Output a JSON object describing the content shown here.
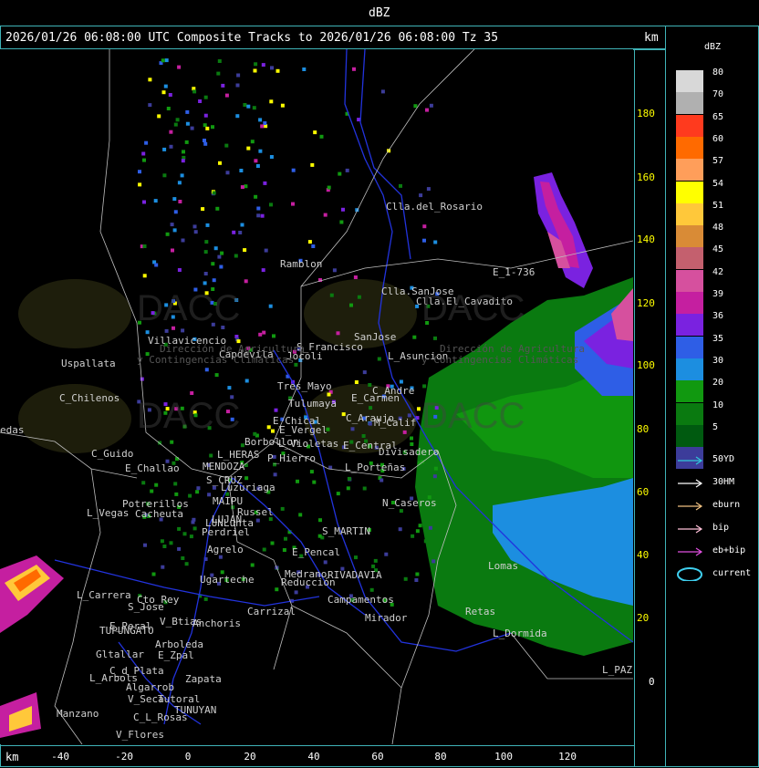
{
  "header": {
    "unit_top": "dBZ",
    "title": "2026/01/26 06:08:00 UTC Composite Tracks to 2026/01/26 06:08:00 Tz 35",
    "km_label_top": "km",
    "km_label_bottom": "km"
  },
  "legend": {
    "title": "dBZ",
    "levels": [
      {
        "value": "80",
        "color": "#d8d8d8"
      },
      {
        "value": "70",
        "color": "#b0b0b0"
      },
      {
        "value": "65",
        "color": "#ff3a1e"
      },
      {
        "value": "60",
        "color": "#ff6a00"
      },
      {
        "value": "57",
        "color": "#ff9e5a"
      },
      {
        "value": "54",
        "color": "#ffff00"
      },
      {
        "value": "51",
        "color": "#ffc83a"
      },
      {
        "value": "48",
        "color": "#d98b36"
      },
      {
        "value": "45",
        "color": "#c4606e"
      },
      {
        "value": "42",
        "color": "#d6509e"
      },
      {
        "value": "39",
        "color": "#c51fa0"
      },
      {
        "value": "36",
        "color": "#7a22e0"
      },
      {
        "value": "35",
        "color": "#2e5ee6"
      },
      {
        "value": "30",
        "color": "#1c8ee0"
      },
      {
        "value": "20",
        "color": "#119910"
      },
      {
        "value": "10",
        "color": "#0a7a10"
      },
      {
        "value": "5",
        "color": "#005a10"
      },
      {
        "value": "",
        "color": "#3c3c9a"
      }
    ],
    "tracks": [
      {
        "label": "50YD",
        "color": "#2fc8d8"
      },
      {
        "label": "30HM",
        "color": "#ffffff"
      },
      {
        "label": "eburn",
        "color": "#f0c080"
      },
      {
        "label": "bip",
        "color": "#ffc0d8"
      },
      {
        "label": "eb+bip",
        "color": "#e050e0"
      },
      {
        "label": "current",
        "color": "#3fd0f0"
      }
    ]
  },
  "y_ticks": [
    "180",
    "160",
    "140",
    "120",
    "100",
    "80",
    "60",
    "40",
    "20",
    "0"
  ],
  "x_ticks": [
    "-40",
    "-20",
    "0",
    "20",
    "40",
    "60",
    "80",
    "100",
    "120"
  ],
  "watermark": {
    "logo": "DACC",
    "line1": "Dirección de Agricultura",
    "line2": "y Contingencias Climáticas"
  },
  "places": [
    "Clla.del_Rosario",
    "Ramblon",
    "Clla.SanJose",
    "Clla.El_Cavadito",
    "Villavicencio",
    "Capdevila",
    "S_Francisco",
    "SanJose",
    "Uspallata",
    "L_Asuncion",
    "Jocoli",
    "Tres_Mayo",
    "C_Chilenos",
    "E_Carmen",
    "Tulumaya",
    "C_Araujo",
    "E_Chical",
    "E_Vergel",
    "C_Andre",
    "M_Calif",
    "Borbollon",
    "L_HERAS",
    "L_Violetas",
    "E_Central",
    "Divisadero",
    "C_Guido",
    "P_Hierro",
    "L_Porteñas",
    "MENDOZA",
    "E_Challao",
    "S_CRUZ",
    "Luzuriaga",
    "MAIPU",
    "Russel",
    "Potrerillos",
    "Cacheuta",
    "LUJAN",
    "LUNLunta",
    "L_Vegas",
    "Perdriel",
    "N_Caseros",
    "S_MARTIN",
    "Agrelo",
    "E_Pencal",
    "Ugarteche",
    "Medrano",
    "Reducción",
    "RIVADAVIA",
    "Campamentos",
    "L_Carrera",
    "Cto_Rey",
    "S_Jose",
    "Carrizal",
    "E_Peral",
    "V_Btias",
    "Anchoris",
    "TUPUNGATO",
    "Arboleda",
    "Gltallar",
    "E_Zpal",
    "Zapata",
    "L_Arbols",
    "C_d_Plata",
    "Algarrob",
    "V_Seca",
    "Tutoral",
    "TUNUYAN",
    "Manzano",
    "C_L_Rosas",
    "V_Flores",
    "Mirador",
    "L_Dormida",
    "L_PAZ",
    "Lomas",
    "E_1-736",
    "Retas",
    "edas"
  ]
}
